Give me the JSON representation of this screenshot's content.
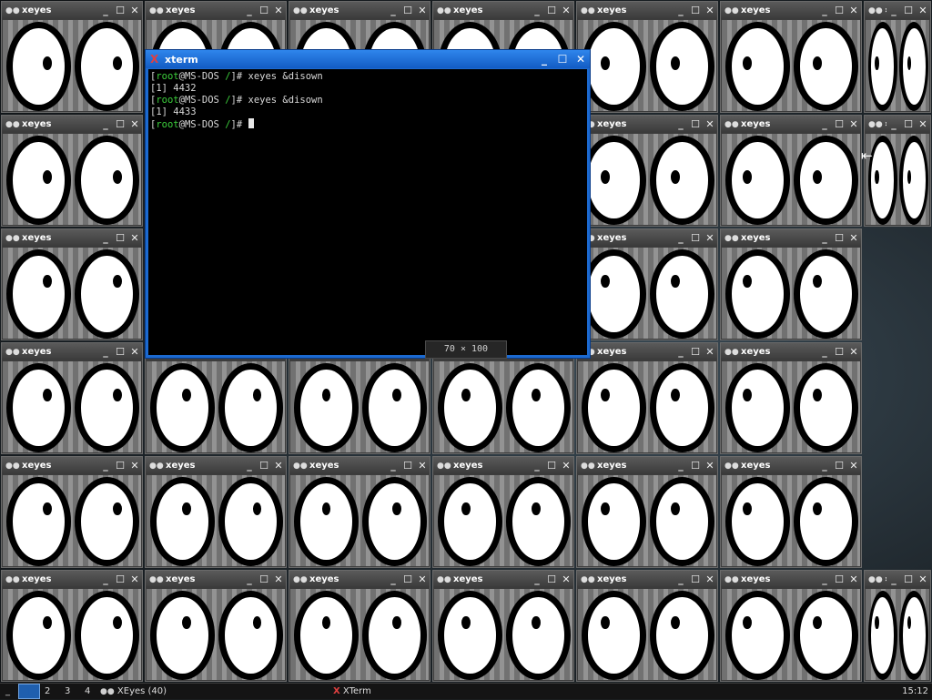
{
  "xeyes": {
    "title": "xeyes",
    "icon": "eyes-icon",
    "buttons": {
      "minimize": "_",
      "maximize": "☐",
      "close": "✕"
    },
    "truncated_title": "x",
    "truncated_icon": "»",
    "count_shown": 40
  },
  "xterm": {
    "title": "xterm",
    "icon": "xterm-x-icon",
    "buttons": {
      "minimize": "_",
      "maximize": "☐",
      "close": "✕"
    },
    "lines": [
      {
        "prompt_open": "[",
        "user": "root",
        "at_host": "@MS-DOS ",
        "path": "/",
        "prompt_close": "]# ",
        "cmd": "xeyes &disown"
      },
      {
        "output": "[1] 4432"
      },
      {
        "prompt_open": "[",
        "user": "root",
        "at_host": "@MS-DOS ",
        "path": "/",
        "prompt_close": "]# ",
        "cmd": "xeyes &disown"
      },
      {
        "output": "[1] 4433"
      },
      {
        "prompt_open": "[",
        "user": "root",
        "at_host": "@MS-DOS ",
        "path": "/",
        "prompt_close": "]# ",
        "cmd": ""
      }
    ],
    "size_tooltip": "70 × 100"
  },
  "taskbar": {
    "menu_label": "_",
    "workspaces": [
      "1",
      "2",
      "3",
      "4"
    ],
    "active_workspace": "1",
    "tasks": [
      {
        "label": "XEyes (40)",
        "icon": "eyes-icon"
      },
      {
        "label": "XTerm",
        "icon": "xterm-x-icon"
      }
    ],
    "clock": "15:12"
  },
  "colors": {
    "xterm_titlebar": "#1c6ad0",
    "prompt_green": "#3ccf3c",
    "window_gray": "#3c3c3c"
  }
}
